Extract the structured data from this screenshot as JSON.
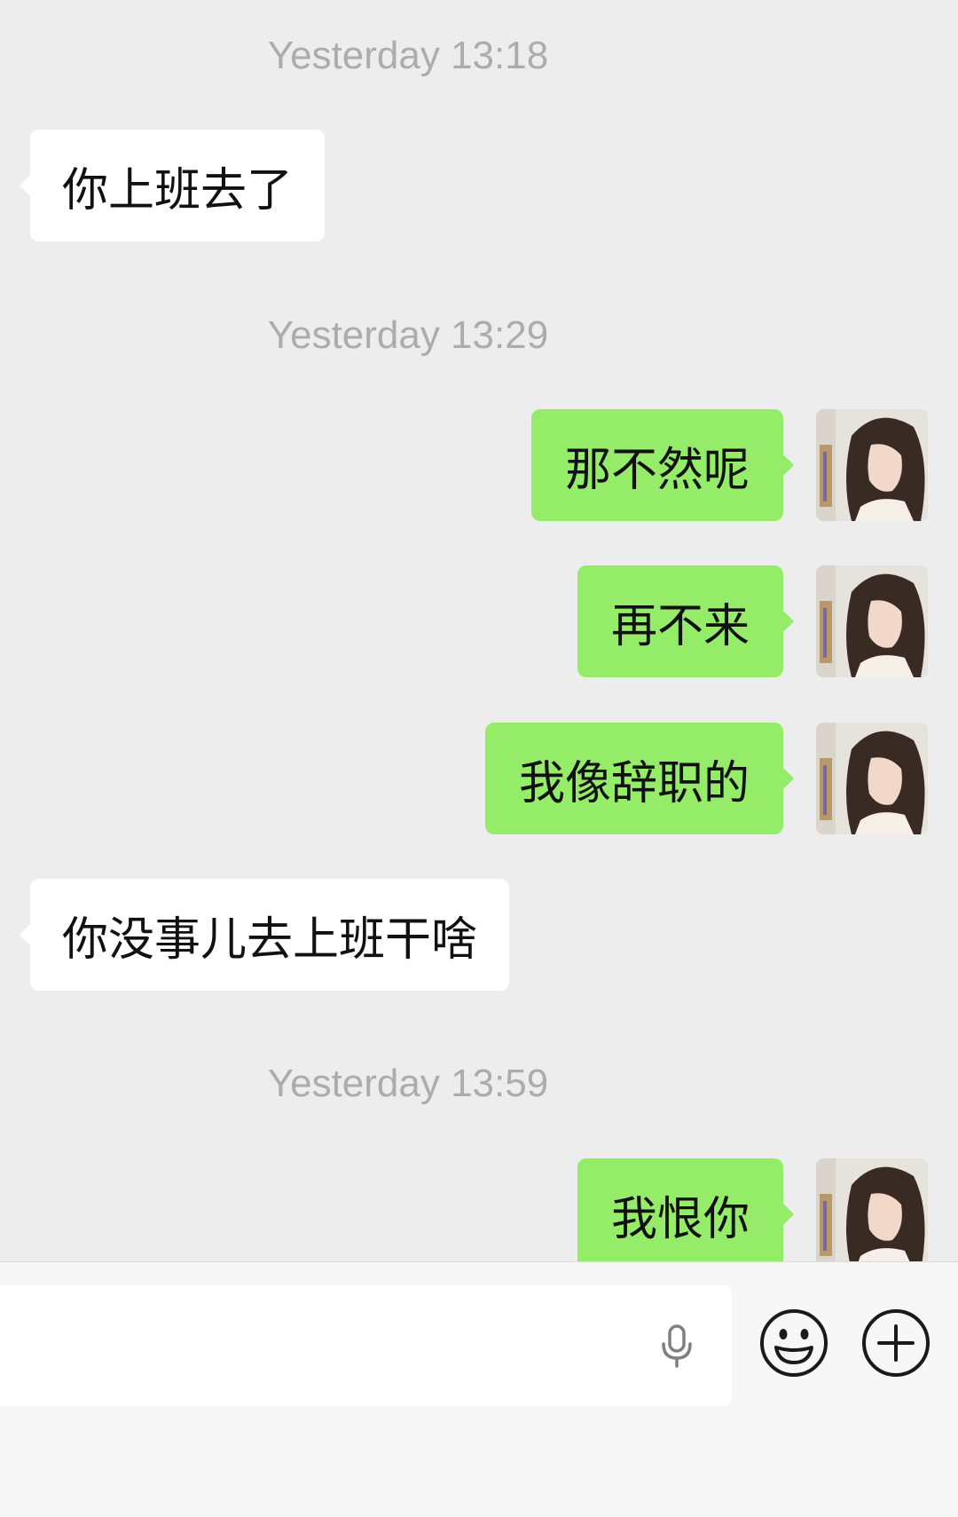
{
  "timestamps": [
    "Yesterday 13:18",
    "Yesterday 13:29",
    "Yesterday 13:59"
  ],
  "messages": [
    {
      "side": "left",
      "text": "你上班去了"
    },
    {
      "side": "right",
      "text": "那不然呢"
    },
    {
      "side": "right",
      "text": "再不来"
    },
    {
      "side": "right",
      "text": "我像辞职的"
    },
    {
      "side": "left",
      "text": "你没事儿去上班干啥"
    },
    {
      "side": "right",
      "text": "我恨你"
    }
  ],
  "colors": {
    "background": "#ededed",
    "sent_bubble": "#95ec69",
    "received_bubble": "#ffffff",
    "timestamp": "#acacac"
  },
  "input_bar": {
    "message_value": "",
    "icons": [
      "microphone-icon",
      "emoji-icon",
      "plus-icon"
    ]
  }
}
